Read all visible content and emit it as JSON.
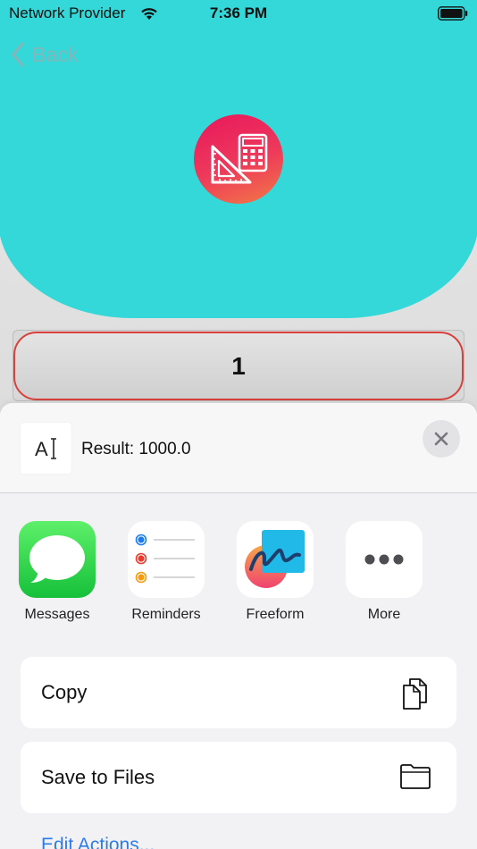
{
  "status_bar": {
    "carrier": "Network Provider",
    "time": "7:36 PM"
  },
  "nav": {
    "back_label": "Back"
  },
  "calculator": {
    "display_value": "1"
  },
  "share_sheet": {
    "preview_title": "Result: 1000.0",
    "apps": [
      {
        "label": "Messages",
        "icon": "messages-icon"
      },
      {
        "label": "Reminders",
        "icon": "reminders-icon"
      },
      {
        "label": "Freeform",
        "icon": "freeform-icon"
      },
      {
        "label": "More",
        "icon": "more-icon"
      }
    ],
    "actions": [
      {
        "label": "Copy",
        "icon": "copy-icon"
      },
      {
        "label": "Save to Files",
        "icon": "folder-icon"
      }
    ],
    "edit_actions_label": "Edit Actions..."
  },
  "colors": {
    "header": "#35d8d8",
    "accent_red": "#d8413c",
    "link_blue": "#2d7bea"
  }
}
